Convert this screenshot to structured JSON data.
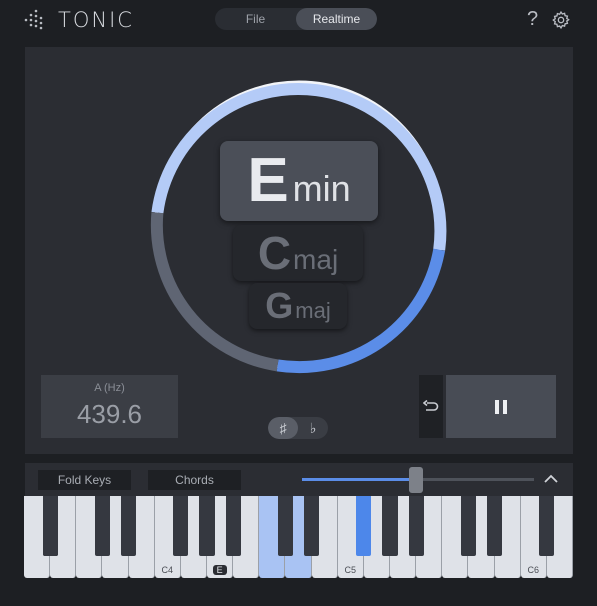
{
  "app": {
    "name": "TONIC"
  },
  "mode_tabs": [
    {
      "label": "File",
      "active": false
    },
    {
      "label": "Realtime",
      "active": true
    }
  ],
  "header": {
    "help_glyph": "?"
  },
  "chords": [
    {
      "root": "E",
      "quality": "min"
    },
    {
      "root": "C",
      "quality": "maj"
    },
    {
      "root": "G",
      "quality": "maj"
    }
  ],
  "ring": {
    "accent": "#5b8de8",
    "light": "#b4cbf7",
    "track": "#5f6573"
  },
  "tuning": {
    "label": "A (Hz)",
    "value": "439.6"
  },
  "accidentals": [
    {
      "label": "♯",
      "active": true
    },
    {
      "label": "♭",
      "active": false
    }
  ],
  "transport": {
    "reset_glyph": "↶",
    "pause_glyph": "❚❚"
  },
  "keyboard_bar": {
    "fold_keys": "Fold Keys",
    "chords": "Chords",
    "slider_level": 0.49
  },
  "piano": {
    "white_keys": 21,
    "lit_white_keys": [
      9,
      10
    ],
    "active_black_key": 8,
    "labels": [
      {
        "key": 5,
        "text": "C4"
      },
      {
        "key": 7,
        "text": "E",
        "tag": true
      },
      {
        "key": 12,
        "text": "C5"
      },
      {
        "key": 19,
        "text": "C6"
      }
    ]
  }
}
